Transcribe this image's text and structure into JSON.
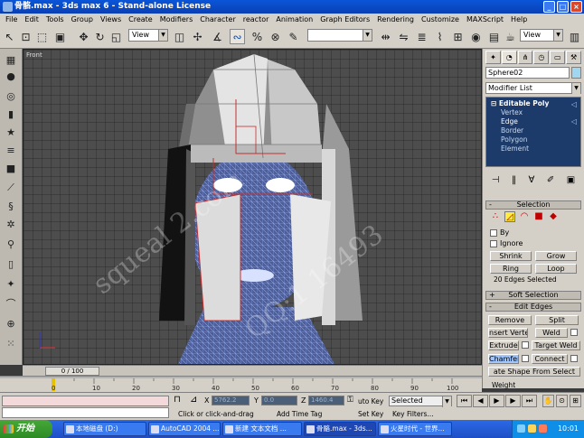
{
  "window": {
    "title": "骨骼.max - 3ds max 6 - Stand-alone License",
    "buttons": {
      "minimize": "_",
      "maximize": "□",
      "close": "×"
    }
  },
  "menu": [
    "File",
    "Edit",
    "Tools",
    "Group",
    "Views",
    "Create",
    "Modifiers",
    "Character",
    "reactor",
    "Animation",
    "Graph Editors",
    "Rendering",
    "Customize",
    "MAXScript",
    "Help"
  ],
  "toolbar": {
    "view_dropdown": "View",
    "view_dropdown_right": "View"
  },
  "viewport": {
    "label": "Front",
    "watermark_1": "squeal 2.com",
    "watermark_2": "QQ:1 16493"
  },
  "command_panel": {
    "object_name": "Sphere02",
    "object_color": "#9fd6f0",
    "modifier_list": "Modifier List",
    "stack": {
      "main": "Editable Poly",
      "items": [
        "Vertex",
        "Edge",
        "Border",
        "Polygon",
        "Element"
      ],
      "selected_index": 1
    },
    "selection": {
      "title": "Selection",
      "by_vertex": "By",
      "ignore": "Ignore",
      "shrink": "Shrink",
      "grow": "Grow",
      "ring": "Ring",
      "loop": "Loop",
      "info": "20 Edges Selected"
    },
    "soft_selection": {
      "title": "Soft Selection"
    },
    "edit_edges": {
      "title": "Edit Edges",
      "remove": "Remove",
      "split": "Split",
      "insert_vertex": "nsert Verte",
      "weld": "Weld",
      "extrude": "Extrude",
      "target_weld": "Target Weld",
      "chamfer": "Chamfer",
      "connect": "Connect",
      "create_shape": "ate Shape From Select",
      "weight": "Weight"
    }
  },
  "timeline": {
    "slider": "0 / 100",
    "ticks": [
      "0",
      "10",
      "20",
      "30",
      "40",
      "50",
      "60",
      "70",
      "80",
      "90",
      "100"
    ]
  },
  "status": {
    "x_label": "X",
    "x_value": "5762.2",
    "y_label": "Y",
    "y_value": "0.0",
    "z_label": "Z",
    "z_value": "1460.4",
    "prompt": "Click or click-and-drag",
    "add_time_tag": "Add Time Tag",
    "auto_key": "uto Key",
    "set_key": "Set Key",
    "key_filters": "Key Filters...",
    "selected": "Selected"
  },
  "taskbar": {
    "start": "开始",
    "items": [
      "本地磁盘 (D:)",
      "AutoCAD 2004 ...",
      "新建 文本文档 ...",
      "骨骼.max - 3ds...",
      "火星时代 - 世界..."
    ],
    "active_index": 3,
    "clock": "10:01"
  }
}
